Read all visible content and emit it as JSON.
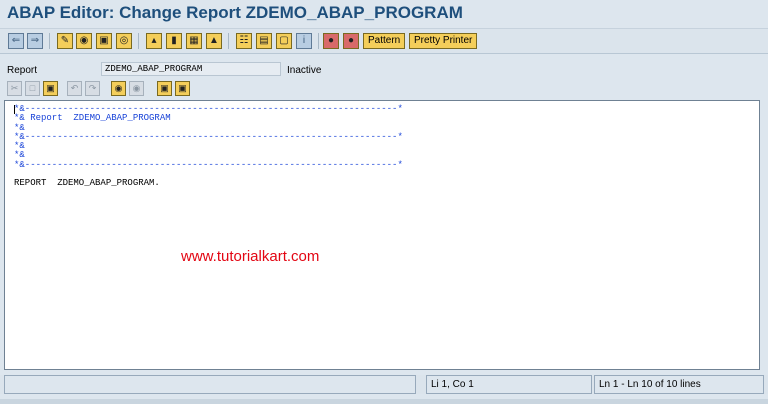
{
  "window": {
    "title": "ABAP Editor: Change Report ZDEMO_ABAP_PROGRAM"
  },
  "toolbar": {
    "icons": [
      "back-icon",
      "forward-icon",
      "display-change-icon",
      "other-object-icon",
      "active-inactive-icon",
      "check-icon",
      "activate-icon",
      "test-icon",
      "where-used-icon",
      "object-list-icon",
      "navigation-window-icon",
      "display-object-list-icon",
      "enhance-icon",
      "help-icon",
      "info-icon",
      "breakpoint-icon",
      "session-breakpoint-icon"
    ],
    "pattern_label": "Pattern",
    "pretty_printer_label": "Pretty Printer"
  },
  "report": {
    "label": "Report",
    "value": "ZDEMO_ABAP_PROGRAM",
    "status": "Inactive"
  },
  "editor": {
    "lines": [
      {
        "text": "*&---------------------------------------------------------------------*",
        "type": "comment"
      },
      {
        "text": "*& Report  ZDEMO_ABAP_PROGRAM",
        "type": "comment"
      },
      {
        "text": "*&",
        "type": "comment"
      },
      {
        "text": "*&---------------------------------------------------------------------*",
        "type": "comment"
      },
      {
        "text": "*&",
        "type": "comment"
      },
      {
        "text": "*&",
        "type": "comment"
      },
      {
        "text": "*&---------------------------------------------------------------------*",
        "type": "comment"
      },
      {
        "text": "",
        "type": "code"
      },
      {
        "text": "REPORT  ZDEMO_ABAP_PROGRAM.",
        "type": "code"
      }
    ]
  },
  "watermark": "www.tutorialkart.com",
  "statusbar": {
    "cursor_pos": "Li 1, Co 1",
    "line_range": "Ln 1 - Ln 10 of 10 lines"
  }
}
